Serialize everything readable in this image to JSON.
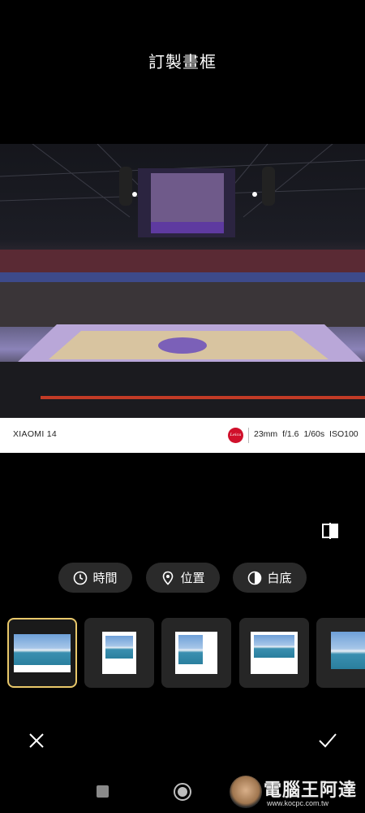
{
  "header": {
    "title": "訂製畫框"
  },
  "preview": {
    "caption": {
      "model": "XIAOMI 14",
      "logo_text": "Leica",
      "specs": "23mm  f/1.6  1/60s  ISO100"
    }
  },
  "options": [
    {
      "label": "時間",
      "icon": "clock-icon"
    },
    {
      "label": "位置",
      "icon": "location-pin-icon"
    },
    {
      "label": "白底",
      "icon": "half-circle-icon"
    }
  ],
  "frame_styles": {
    "selected_index": 0,
    "count_visible": 5
  },
  "actions": {
    "cancel_icon": "close-icon",
    "confirm_icon": "check-icon"
  },
  "watermark": {
    "text": "電腦王阿達",
    "url": "www.kocpc.com.tw"
  },
  "colors": {
    "background": "#000000",
    "pill": "#2a2a2a",
    "selected_border": "#e9c86a",
    "leica_red": "#d0102b"
  }
}
